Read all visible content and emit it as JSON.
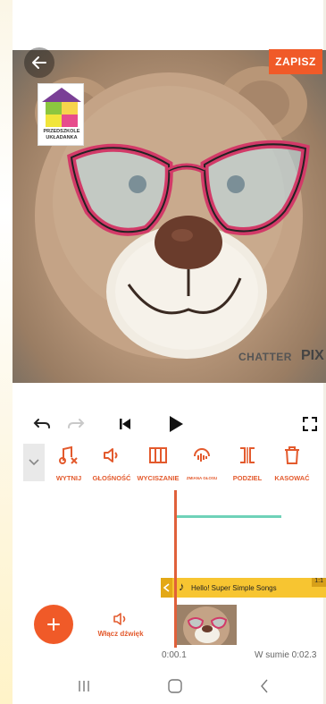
{
  "header": {
    "save_label": "ZAPISZ",
    "back_icon": "arrow-left-icon"
  },
  "logo": {
    "line1": "PRZEDSZKOLE",
    "line2": "UKŁADANKA"
  },
  "watermark": {
    "part1": "CHATTER",
    "part2": "PIX"
  },
  "playback": {
    "undo_icon": "undo-icon",
    "redo_icon": "redo-icon",
    "skip_start_icon": "skip-to-start-icon",
    "play_icon": "play-icon",
    "fullscreen_icon": "fullscreen-icon"
  },
  "toolbar": {
    "items": [
      {
        "label": "WYTNIJ",
        "icon": "cut-music-icon"
      },
      {
        "label": "GŁOŚNOŚĆ",
        "icon": "volume-icon"
      },
      {
        "label": "WYCISZANIE",
        "icon": "fade-icon"
      },
      {
        "label": "ZMIANA GŁOSU",
        "icon": "voice-change-icon"
      },
      {
        "label": "PODZIEL",
        "icon": "split-icon"
      },
      {
        "label": "KASOWAĆ",
        "icon": "trash-icon"
      }
    ]
  },
  "timeline": {
    "audio_track": "Hello!  Super Simple Songs",
    "audio_duration": "1:1",
    "current_time": "0:00.1",
    "total_time": "W sumie 0:02.3"
  },
  "bottom": {
    "add_icon": "plus-icon",
    "sound_label": "Włącz dźwięk"
  },
  "colors": {
    "accent": "#f05a28",
    "audio_track": "#f7c531",
    "green_track": "#6fd2b8"
  }
}
